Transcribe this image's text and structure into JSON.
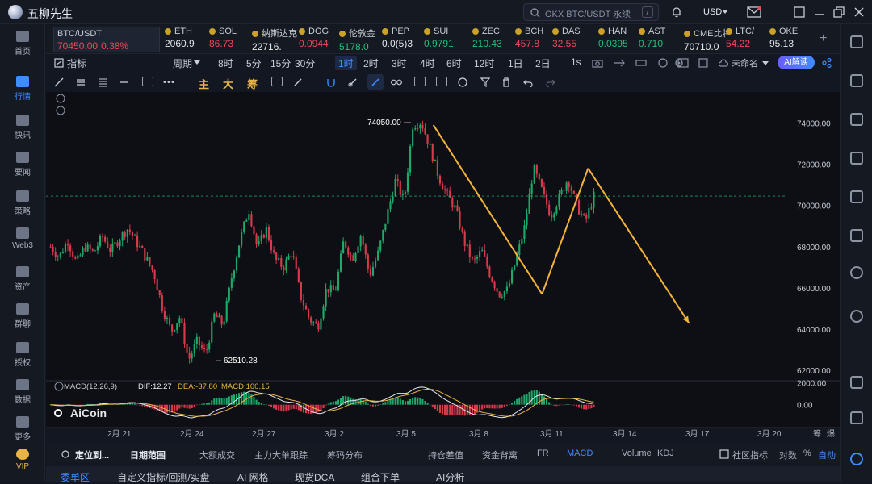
{
  "app": {
    "title": "五柳先生"
  },
  "search": {
    "placeholder": "OKX BTC/USDT 永续",
    "shortcut": "/"
  },
  "currency": "USD",
  "left_nav": [
    {
      "label": "首页"
    },
    {
      "label": "行情",
      "active": true
    },
    {
      "label": "快讯"
    },
    {
      "label": "要闻"
    },
    {
      "label": "策略"
    },
    {
      "label": "Web3"
    },
    {
      "label": "资产"
    },
    {
      "label": "群聊"
    },
    {
      "label": "授权"
    },
    {
      "label": "数据"
    },
    {
      "label": "更多"
    },
    {
      "label": "VIP"
    }
  ],
  "tickers": [
    {
      "name": "BTC/USDT",
      "price": "70450.00",
      "change": "0.38%",
      "color": "red",
      "active": true
    },
    {
      "name": "ETH",
      "price": "2060.9",
      "color": "white"
    },
    {
      "name": "SOL",
      "price": "86.73",
      "color": "red"
    },
    {
      "name": "纳斯达克",
      "price": "22716.",
      "color": "white"
    },
    {
      "name": "DOG",
      "price": "0.0944",
      "color": "red"
    },
    {
      "name": "伦敦金",
      "price": "5178.0",
      "color": "green"
    },
    {
      "name": "PEP",
      "price": "0.0(5)3",
      "color": "white"
    },
    {
      "name": "SUI",
      "price": "0.9791",
      "color": "green"
    },
    {
      "name": "ZEC",
      "price": "210.43",
      "color": "green"
    },
    {
      "name": "BCH",
      "price": "457.8",
      "color": "red"
    },
    {
      "name": "DAS",
      "price": "32.55",
      "color": "red"
    },
    {
      "name": "HAN",
      "price": "0.0395",
      "color": "green"
    },
    {
      "name": "AST",
      "price": "0.710",
      "color": "green"
    },
    {
      "name": "CME比特",
      "price": "70710.0",
      "color": "white"
    },
    {
      "name": "LTC/",
      "price": "54.22",
      "color": "red"
    },
    {
      "name": "OKE",
      "price": "95.13",
      "color": "white"
    }
  ],
  "toolbar": {
    "indicator": "指标",
    "period": "周期",
    "timeframes": [
      "8时",
      "5分",
      "15分",
      "30分",
      "1时",
      "2时",
      "3时",
      "4时",
      "6时",
      "12时",
      "1日",
      "2日",
      "1s"
    ],
    "active_timeframe": "1时",
    "layout_name": "未命名",
    "ai_button": "AI解读"
  },
  "draw_tools": {
    "zh_labels": [
      "主",
      "大",
      "筹"
    ]
  },
  "chart_data": {
    "type": "candlestick",
    "instrument": "BTC/USDT",
    "ylim": [
      61500,
      75500
    ],
    "y_ticks": [
      "74000.00",
      "72000.00",
      "70000.00",
      "68000.00",
      "66000.00",
      "64000.00",
      "62000.00"
    ],
    "x_ticks": [
      "2月 21",
      "2月 24",
      "2月 27",
      "3月 2",
      "3月 5",
      "3月 8",
      "3月 11",
      "3月 14",
      "3月 17",
      "3月 20"
    ],
    "annotations": [
      {
        "text": "74050.00",
        "type": "high"
      },
      {
        "text": "62510.28",
        "type": "low"
      }
    ],
    "price_line": 70450,
    "macd_label": "MACD(12,26,9)",
    "dif": "DIF:12.27",
    "dea": "DEA:-37.80",
    "macd": "MACD:100.15",
    "macd_y_ticks": [
      "2000.00",
      "0.00"
    ],
    "watermark": "AiCoin",
    "close_path": [
      68000,
      67500,
      68300,
      67200,
      68000,
      67700,
      68500,
      67800,
      68400,
      68900,
      68200,
      67500,
      66700,
      65000,
      63900,
      64600,
      62500,
      63400,
      62800,
      64700,
      64200,
      66500,
      68400,
      69800,
      67900,
      68900,
      67400,
      67000,
      67800,
      65600,
      64500,
      64100,
      66000,
      65800,
      68300,
      67400,
      68600,
      66600,
      67700,
      69500,
      71200,
      70200,
      73900,
      74050,
      72800,
      71400,
      70500,
      69800,
      68200,
      67200,
      67800,
      66600,
      65700,
      65900,
      67400,
      69000,
      71800,
      70700,
      69500,
      70400,
      71300,
      70000,
      69200,
      70450
    ],
    "candle_count": 220,
    "drawn_path": [
      [
        73900,
        0.488
      ],
      [
        65700,
        0.625
      ],
      [
        71800,
        0.683
      ],
      [
        64300,
        0.81
      ]
    ]
  },
  "bottom_tabs": [
    "定位到...",
    "日期范围",
    "大额成交",
    "主力大单跟踪",
    "筹码分布",
    "持仓差值",
    "资金背离",
    "FR",
    "MACD",
    "Volume",
    "KDJ",
    "社区指标",
    "对数",
    "%",
    "自动"
  ],
  "active_bottom_tab": "MACD",
  "footer_tabs": [
    "委单区",
    "自定义指标/回测/实盘",
    "AI 网格",
    "现货DCA",
    "组合下单",
    "AI分析"
  ],
  "corner": {
    "label_a": "筹",
    "label_b": "爆"
  }
}
